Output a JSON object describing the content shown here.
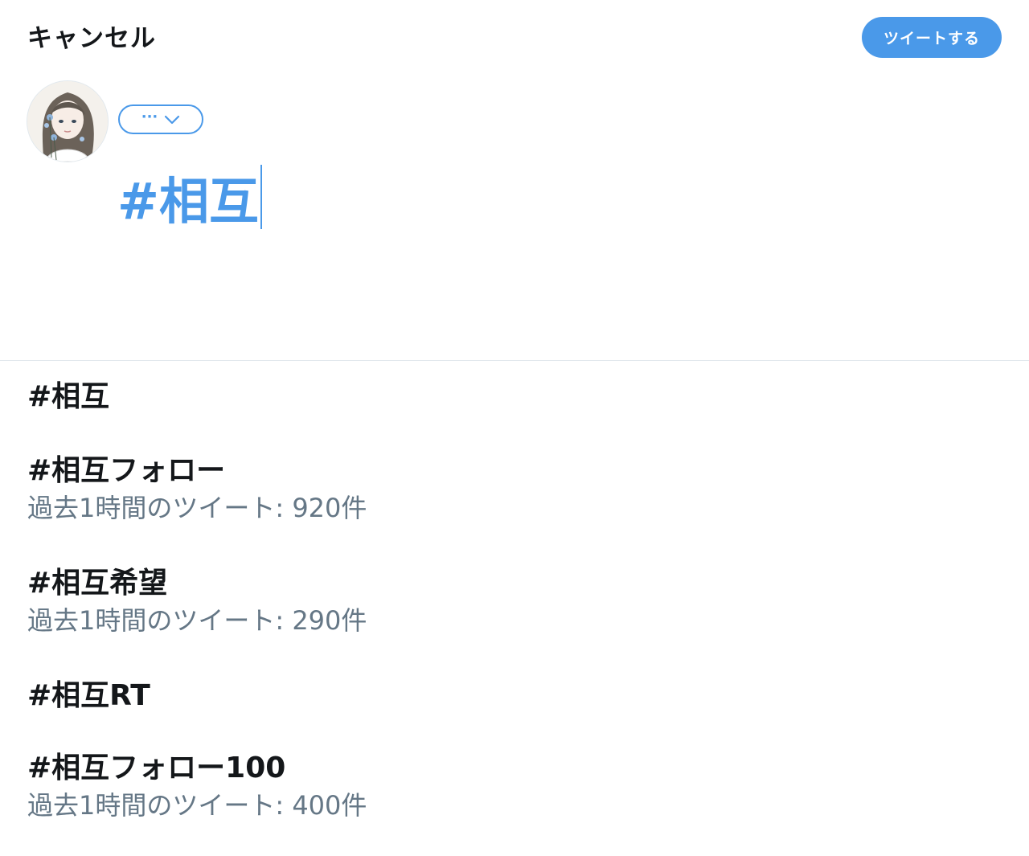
{
  "header": {
    "cancel_label": "キャンセル",
    "tweet_button_label": "ツイートする"
  },
  "composer": {
    "audience_icon": "ellipsis-chevron-down-icon",
    "text": "#相互"
  },
  "suggestions": [
    {
      "tag": "#相互",
      "count": ""
    },
    {
      "tag": "#相互フォロー",
      "count": "過去1時間のツイート: 920件"
    },
    {
      "tag": "#相互希望",
      "count": "過去1時間のツイート: 290件"
    },
    {
      "tag": "#相互RT",
      "count": ""
    },
    {
      "tag": "#相互フォロー100",
      "count": "過去1時間のツイート: 400件"
    }
  ],
  "colors": {
    "accent": "#4a99e9",
    "text": "#14171a",
    "secondary_text": "#657786",
    "divider": "#e1e8ed"
  }
}
